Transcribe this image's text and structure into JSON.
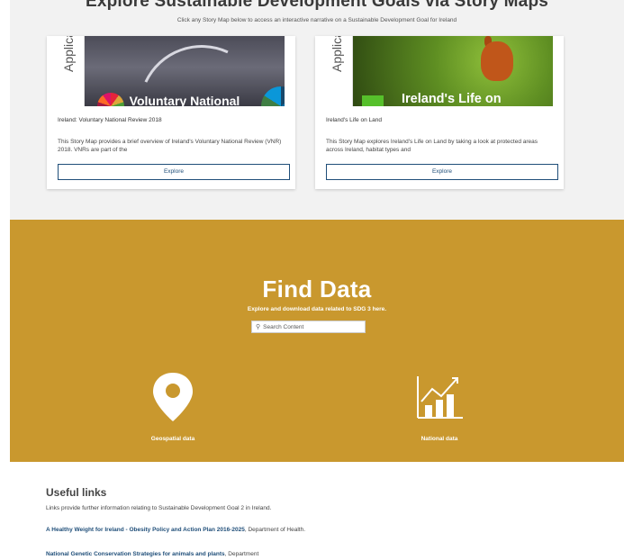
{
  "story_maps": {
    "title": "Explore Sustainable Development Goals via Story Maps",
    "subtitle": "Click any Story Map below to access an interactive narrative on a Sustainable Development Goal for Ireland",
    "cards": [
      {
        "thumb_strip_text": "Applica",
        "thumb_overlay": "Voluntary National",
        "title": "Ireland: Voluntary National Review 2018",
        "description": "This Story Map provides a brief overview of Ireland's Voluntary National Review (VNR) 2018. VNRs are part of the",
        "button_label": "Explore"
      },
      {
        "thumb_strip_text": "Applica",
        "thumb_overlay": "Ireland's Life on",
        "title": "Ireland's Life on Land",
        "description": "This Story Map explores Ireland's Life on Land by taking a look at protected areas across Ireland, habitat types and",
        "button_label": "Explore"
      }
    ]
  },
  "find_data": {
    "title": "Find Data",
    "subtitle": "Explore and download data related to SDG 3 here.",
    "search_placeholder": "Search Content",
    "search_icon": "search-icon",
    "links": [
      {
        "label": "Geospatial data",
        "icon": "map-pin-icon"
      },
      {
        "label": "National data",
        "icon": "bar-chart-trend-icon"
      }
    ],
    "color": "#c9982e"
  },
  "useful_links": {
    "title": "Useful links",
    "description": "Links provide further information relating to Sustainable Development Goal 2 in Ireland.",
    "items": [
      {
        "link_text": "A Healthy Weight for Ireland - Obesity Policy and Action Plan 2016-2025",
        "suffix": ", Department of Health."
      },
      {
        "link_text": "National Genetic Conservation Strategies for animals and plants",
        "suffix": ", Department"
      }
    ]
  },
  "colors": {
    "link": "#1f4e79",
    "band": "#c9982e"
  }
}
